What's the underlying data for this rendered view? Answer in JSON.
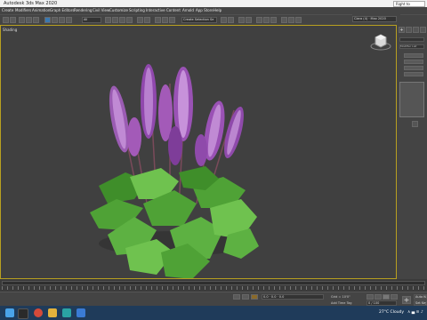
{
  "app": {
    "title": "Autodesk 3ds Max 2020",
    "workspace_tab": "Right to"
  },
  "menu": [
    "Create",
    "Modifiers",
    "Animation",
    "Graph Editors",
    "Rendering",
    "Civil View",
    "Customize",
    "Scripting",
    "Interactive",
    "Content",
    "Arnold",
    "App Store",
    "Help"
  ],
  "toolbar": {
    "selection_filter": "All",
    "selection_set": "Create Selection Se",
    "account": "Clara (4) · Max 2020"
  },
  "viewport": {
    "label": "Shading"
  },
  "right_panel": {
    "modifier_list": "Modifier List"
  },
  "timeline": {
    "slider_value": "0 / 100"
  },
  "status": {
    "coords": "0.0 · 0.0 · 0.0",
    "grid": "Grid = 10'0\"",
    "add_time_tag": "Add Time Tag",
    "auto_key": "Auto Key",
    "set_key": "Set Key"
  },
  "taskbar": {
    "weather": "27°C Cloudy",
    "tray": "∧ ▄ ≡ ♪",
    "colors": {
      "start": "#4aa3e8",
      "explorer": "#e3b23c",
      "chrome": "#d44a3a",
      "max": "#2aa3a3",
      "app": "#3a7bd5"
    }
  },
  "colors": {
    "viewport_bg": "#404040",
    "active_border": "#b8a020",
    "accent": "#3a78b0"
  }
}
